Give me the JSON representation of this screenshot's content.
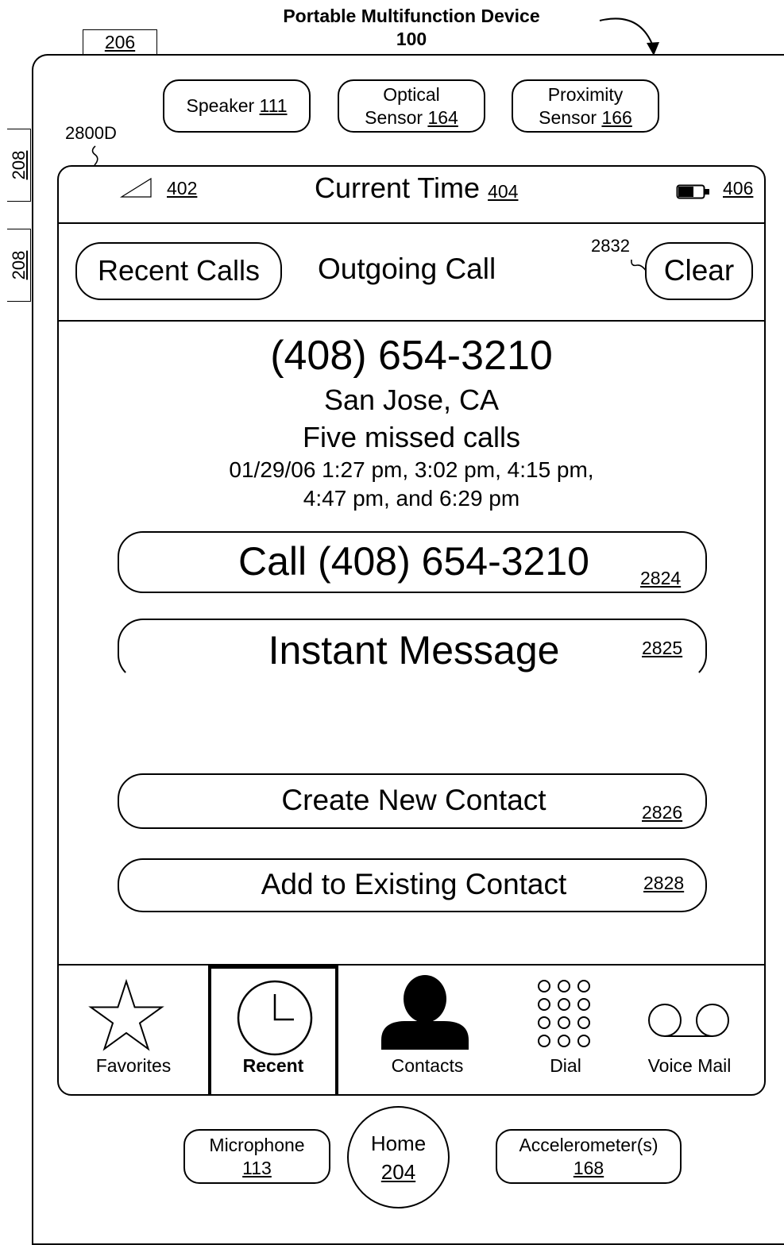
{
  "figure": {
    "title": "Portable Multifunction Device",
    "device_ref": "100",
    "ref_206": "206",
    "ref_208": "208",
    "screen_ref": "2800D",
    "clear_ref": "2832"
  },
  "hardware": {
    "speaker": {
      "label": "Speaker",
      "ref": "111"
    },
    "optical": {
      "label": "Optical",
      "label2": "Sensor",
      "ref": "164"
    },
    "proximity": {
      "label": "Proximity",
      "label2": "Sensor",
      "ref": "166"
    },
    "microphone": {
      "label": "Microphone",
      "ref": "113"
    },
    "home": {
      "label": "Home",
      "ref": "204"
    },
    "accelerometer": {
      "label": "Accelerometer(s)",
      "ref": "168"
    }
  },
  "status_bar": {
    "signal_ref": "402",
    "time_label": "Current Time",
    "time_ref": "404",
    "battery_ref": "406"
  },
  "nav": {
    "back_label": "Recent Calls",
    "title": "Outgoing Call",
    "clear_label": "Clear"
  },
  "call_info": {
    "number": "(408) 654-3210",
    "location": "San Jose, CA",
    "missed": "Five missed calls",
    "times_line1": "01/29/06 1:27 pm, 3:02 pm, 4:15 pm,",
    "times_line2": "4:47 pm, and 6:29 pm"
  },
  "actions": {
    "call": {
      "label": "Call (408) 654-3210",
      "ref": "2824"
    },
    "im": {
      "label": "Instant Message",
      "ref": "2825"
    },
    "create": {
      "label": "Create New Contact",
      "ref": "2826"
    },
    "add": {
      "label": "Add to Existing Contact",
      "ref": "2828"
    }
  },
  "tabs": [
    {
      "label": "Favorites",
      "icon": "star-icon",
      "selected": false
    },
    {
      "label": "Recent",
      "icon": "clock-icon",
      "selected": true
    },
    {
      "label": "Contacts",
      "icon": "person-icon",
      "selected": false
    },
    {
      "label": "Dial",
      "icon": "keypad-icon",
      "selected": false
    },
    {
      "label": "Voice Mail",
      "icon": "voicemail-icon",
      "selected": false
    }
  ]
}
